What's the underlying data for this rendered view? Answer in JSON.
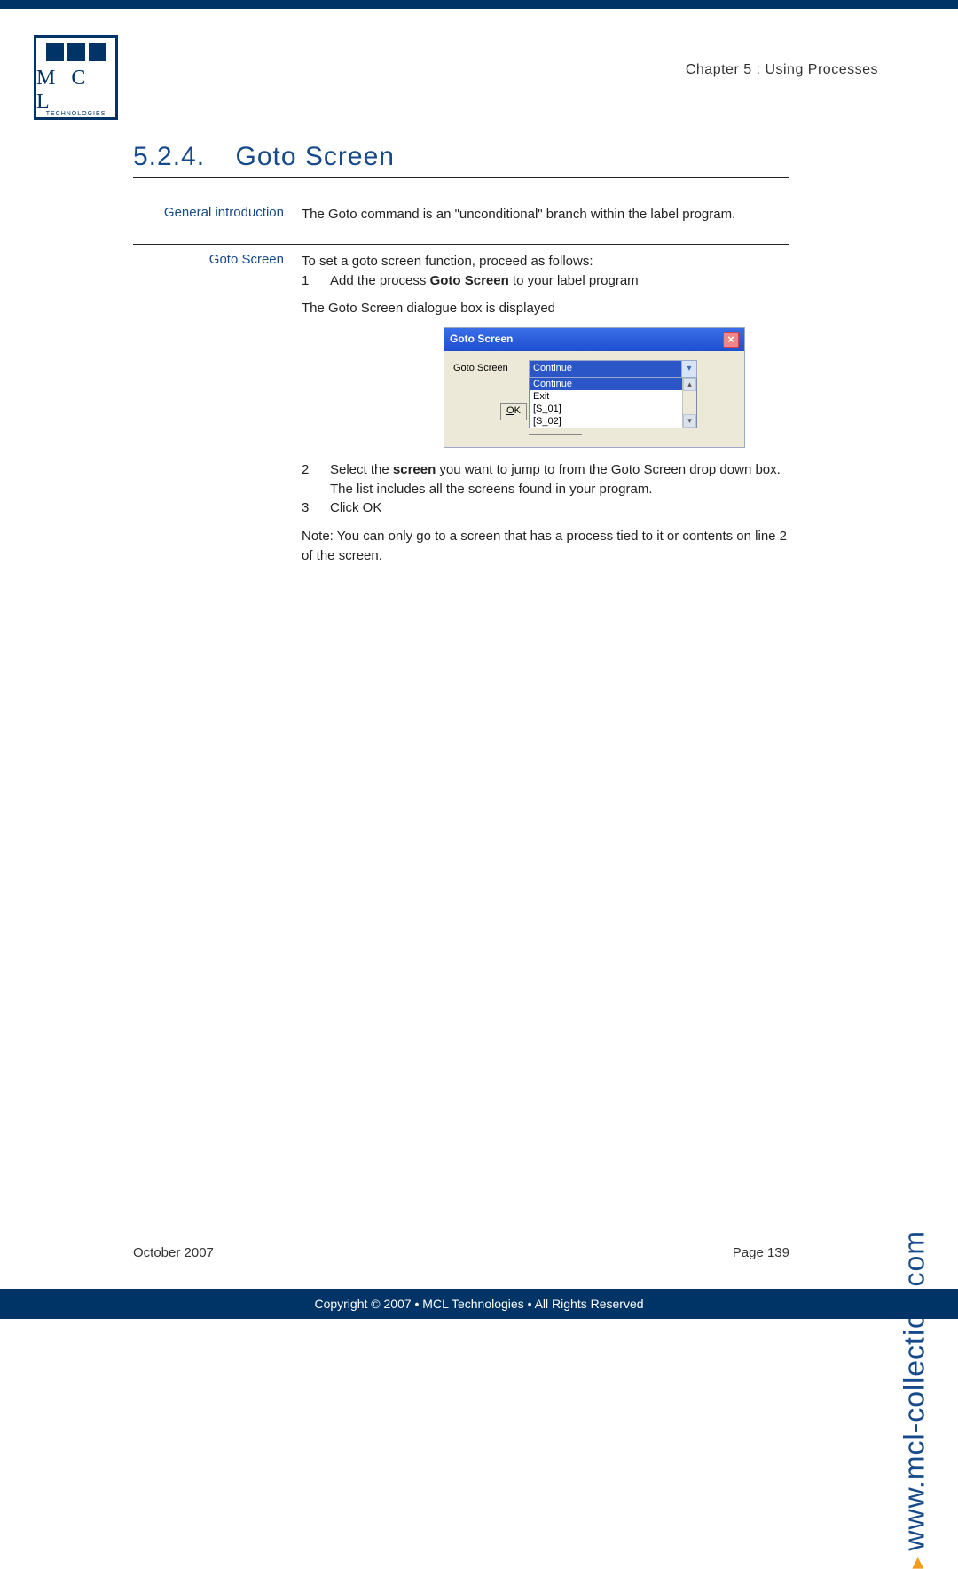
{
  "header": {
    "chapter": "Chapter 5 : Using Processes"
  },
  "logo": {
    "letters": "M C L",
    "sub": "TECHNOLOGIES"
  },
  "section": {
    "number": "5.2.4.",
    "title": "Goto Screen"
  },
  "intro": {
    "label": "General introduction",
    "text": "The Goto command is an \"unconditional\" branch within the label program."
  },
  "proc": {
    "label": "Goto Screen",
    "lead": "To set a goto screen function, proceed as follows:",
    "step1_num": "1",
    "step1_text_a": "Add the process ",
    "step1_text_b": "Goto Screen",
    "step1_text_c": " to your label program",
    "dialog_line": "The Goto Screen dialogue box is displayed",
    "step2_num": "2",
    "step2_text_a": "Select the ",
    "step2_text_b": "screen",
    "step2_text_c": " you want to jump to from the Goto Screen drop down box. The list includes all the screens found in your program.",
    "step3_num": "3",
    "step3_text": "Click OK",
    "note": "Note: You can only go to a screen that has a process tied to it or contents on line 2 of the screen."
  },
  "dialog": {
    "title": "Goto Screen",
    "field_label": "Goto Screen",
    "selected": "Continue",
    "options": [
      "Continue",
      "Exit",
      "[S_01]",
      "[S_02]"
    ],
    "ok": "OK"
  },
  "footer": {
    "date": "October 2007",
    "page": "Page 139"
  },
  "copyright": "Copyright © 2007 • MCL Technologies • All Rights Reserved",
  "side_url": "www.mcl-collection.com"
}
